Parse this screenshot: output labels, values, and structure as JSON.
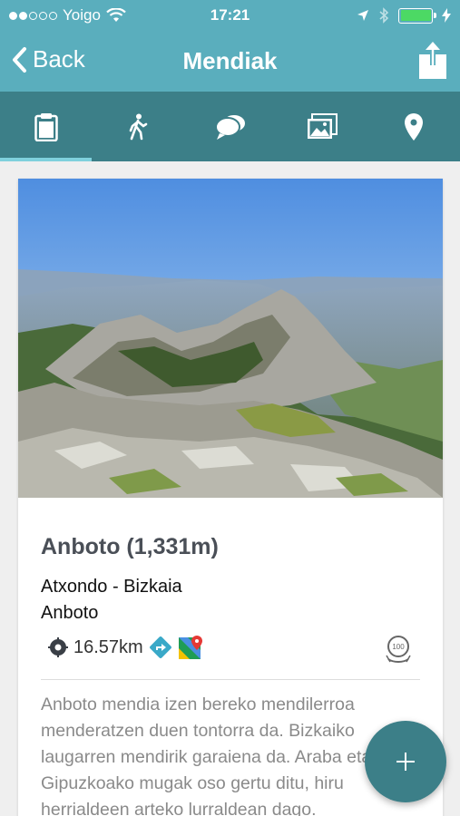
{
  "status_bar": {
    "carrier": "Yoigo",
    "time": "17:21",
    "battery_color": "#4cd964"
  },
  "nav": {
    "back_label": "Back",
    "title": "Mendiak",
    "share_icon": "share-icon"
  },
  "tabs": [
    {
      "icon": "clipboard-icon",
      "active": true
    },
    {
      "icon": "hiker-icon",
      "active": false
    },
    {
      "icon": "comments-icon",
      "active": false
    },
    {
      "icon": "photos-icon",
      "active": false
    },
    {
      "icon": "location-pin-icon",
      "active": false
    }
  ],
  "mountain": {
    "title": "Anboto (1,331m)",
    "location": "Atxondo - Bizkaia",
    "range": "Anboto",
    "distance": "16.57km",
    "badge_number": "100",
    "description": "Anboto mendia izen bereko mendilerroa menderatzen duen tontorra da. Bizkaiko laugarren mendirik garaiena da. Araba eta Gipuzkoako mugak oso gertu ditu, hiru herrialdeen arteko lurraldean dago."
  },
  "colors": {
    "header": "#5aaebd",
    "tabbar": "#3c7f88",
    "tab_active_indicator": "#7fd0dc",
    "fab": "#3c7f88"
  }
}
